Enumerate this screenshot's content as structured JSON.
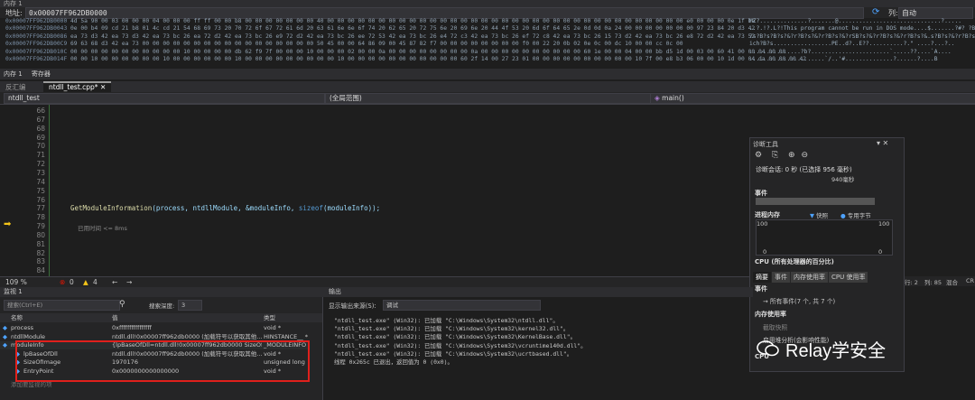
{
  "memory_window": {
    "title": "内存 1",
    "address_label": "地址:",
    "address_value": "0x00007FF962DB0000",
    "columns_label": "列:",
    "columns_value": "自动",
    "rows": [
      {
        "addr": "0x00007FF962DB0000",
        "hex": "4d 5a 90 00 03 00 00 00 04 00 00 00 ff ff 00 00 b8 00 00 00 00 00 00 00 40 00 00 00 00 00 00 00 00 00 00 00 00 00 00 00 00 00 00 00 00 00 00 00 00 00 00 00 00 00 00 00 00 00 00 00 e0 00 00 00 0e 1f ba",
        "ascii": "MZ?..............?.......@..............................?....."
      },
      {
        "addr": "0x00007FF962DB0043",
        "hex": "0e 00 b4 09 cd 21 b8 01 4c cd 21 54 68 69 73 20 70 72 6f 67 72 61 6d 20 63 61 6e 6e 6f 74 20 62 65 20 72 75 6e 20 69 6e 20 44 4f 53 20 6d 6f 64 65 2e 0d 0d 0a 24 00 00 00 00 00 00 00 97 23 84 20 d3 42",
        "ascii": "..?.!?.L?!This program cannot be run in DOS mode....$.......?#? ?B"
      },
      {
        "addr": "0x00007FF962DB0086",
        "hex": "ea 73 d3 42 ea 73 d3 42 ea 73 bc 26 ea 72 d2 42 ea 73 bc 26 e9 72 d2 42 ea 73 bc 26 ee 72 53 42 ea 73 bc 26 e4 72 c3 42 ea 73 bc 26 ef 72 c8 42 ea 73 bc 26 15 73 d2 42 ea 73 bc 26 e8 72 d2 42 ea 73 52",
        "ascii": "?s?B?s?B?s?&?r?B?s?&?r?B?s?&?rSB?s?&?r?B?s?&?r?B?s?&.s?B?s?&?r?B?sR"
      },
      {
        "addr": "0x00007FF962DB00C9",
        "hex": "69 63 68 d3 42 ea 73 00 00 00 00 00 00 00 00 00 00 00 00 00 00 00 00 00 50 45 00 00 64 86 09 00 45 87 82 f7 00 00 00 00 00 00 00 00 f0 00 22 20 0b 02 0e 0c 00 dc 10 00 00 cc 0c 00",
        "ascii": "ich?B?s.................PE..d?..E??..........?.\" ....?...?.."
      },
      {
        "addr": "0x00007FF962DB010C",
        "hex": "00 00 00 00 00 00 00 00 00 00 00 10 00 00 00 00 db 62 f9 7f 00 00 00 10 00 00 00 02 00 00 0a 00 00 00 00 00 00 00 00 0a 00 00 00 00 00 00 00 00 00 00 60 1e 00 00 04 00 00 bb d5 1d 00 03 00 60 41 00 00 04 00 00",
        "ascii": "...............?b?.......................`.....??....`A...."
      },
      {
        "addr": "0x00007FF962DB014F",
        "hex": "00 00 10 00 00 00 00 00 00 10 00 00 00 00 00 00 10 00 00 00 00 00 00 00 00 00 10 00 00 00 00 00 00 00 00 00 00 00 60 2f 14 00 27 23 01 00 00 00 00 00 00 00 00 00 00 10 7f 00 e8 b3 06 00 00 10 1d 00 04 da 00 00 00 42",
        "ascii": "......................`/..'#..............?......?....B"
      }
    ],
    "tabs": [
      "内存 1",
      "寄存器"
    ]
  },
  "editor": {
    "left_tab": "反汇编",
    "file_tab": "ntdll_test.cpp*",
    "project_dropdown": "ntdll_test",
    "scope_dropdown": "(全局范围)",
    "func_dropdown": "main()",
    "line_numbers": [
      "66",
      "67",
      "68",
      "69",
      "70",
      "71",
      "72",
      "73",
      "74",
      "75",
      "76",
      "77",
      "78",
      "79",
      "80",
      "81",
      "82",
      "83",
      "84"
    ],
    "code": {
      "fn": "GetModuleInformation",
      "args_pre": "(process, ntdllModule, &moduleInfo, ",
      "kw": "sizeof",
      "args_post": "(moduleInfo));"
    },
    "hint": "已用时间 <= 8ms",
    "zoom": "109 %",
    "errors": "0",
    "warnings": "4"
  },
  "diagnostics": {
    "title": "诊断工具",
    "session": "诊断会话: 0 秒 (已选择 956 毫秒)",
    "tick": "940毫秒",
    "events": "事件",
    "process_memory": "进程内存",
    "snapshot": "快照",
    "private_bytes": "专用字节",
    "mem_max": "100",
    "mem_max_right": "100",
    "mem_min": "0",
    "mem_min_right": "0",
    "cpu": "CPU (所有处理器的百分比)",
    "tabs": [
      "摘要",
      "事件",
      "内存使用率",
      "CPU 使用率"
    ],
    "events_section": "事件",
    "all_events": "所有事件(7 个, 共 7 个)",
    "mem_usage": "内存使用率",
    "take_snapshot": "截取快照",
    "heap_analysis": "启用堆分析(会影响性能)",
    "cpu_section": "CPU"
  },
  "right_status": [
    "行: 2",
    "列: 85",
    "混合",
    "CR"
  ],
  "watch": {
    "title": "监视 1",
    "search_placeholder": "搜索(Ctrl+E)",
    "depth_label": "搜索深度:",
    "depth_value": "3",
    "col_name": "名称",
    "col_value": "值",
    "col_type": "类型",
    "rows": [
      {
        "name": "process",
        "value": "0xffffffffffffffff",
        "type": "void *"
      },
      {
        "name": "ntdllModule",
        "value": "ntdll.dll!0x00007ff962db0000 (加载符号以获取其他...",
        "type": "HINSTANCE__ *"
      },
      {
        "name": "moduleInfo",
        "value": "{lpBaseOfDll=ntdll.dll!0x00007ff962db0000 SizeOfIm...",
        "type": "_MODULEINFO"
      },
      {
        "name": "lpBaseOfDll",
        "value": "ntdll.dll!0x00007ff962db0000 (加载符号以获取其他...",
        "type": "void *"
      },
      {
        "name": "SizeOfImage",
        "value": "1970176",
        "type": "unsigned long"
      },
      {
        "name": "EntryPoint",
        "value": "0x0000000000000000",
        "type": "void *"
      }
    ],
    "add_hint": "添加要监视的项"
  },
  "output": {
    "title": "输出",
    "source_label": "显示输出来源(S):",
    "source_value": "调试",
    "lines": [
      "\"ntdll_test.exe\" (Win32): 已加载 \"C:\\Windows\\System32\\ntdll.dll\"。",
      "\"ntdll_test.exe\" (Win32): 已加载 \"C:\\Windows\\System32\\kernel32.dll\"。",
      "\"ntdll_test.exe\" (Win32): 已加载 \"C:\\Windows\\System32\\KernelBase.dll\"。",
      "\"ntdll_test.exe\" (Win32): 已加载 \"C:\\Windows\\System32\\vcruntime140d.dll\"。",
      "\"ntdll_test.exe\" (Win32): 已加载 \"C:\\Windows\\System32\\ucrtbased.dll\"。",
      "线程 0x265c 已退出，返回值为 0 (0x0)。"
    ]
  },
  "watermark": "Relay学安全"
}
